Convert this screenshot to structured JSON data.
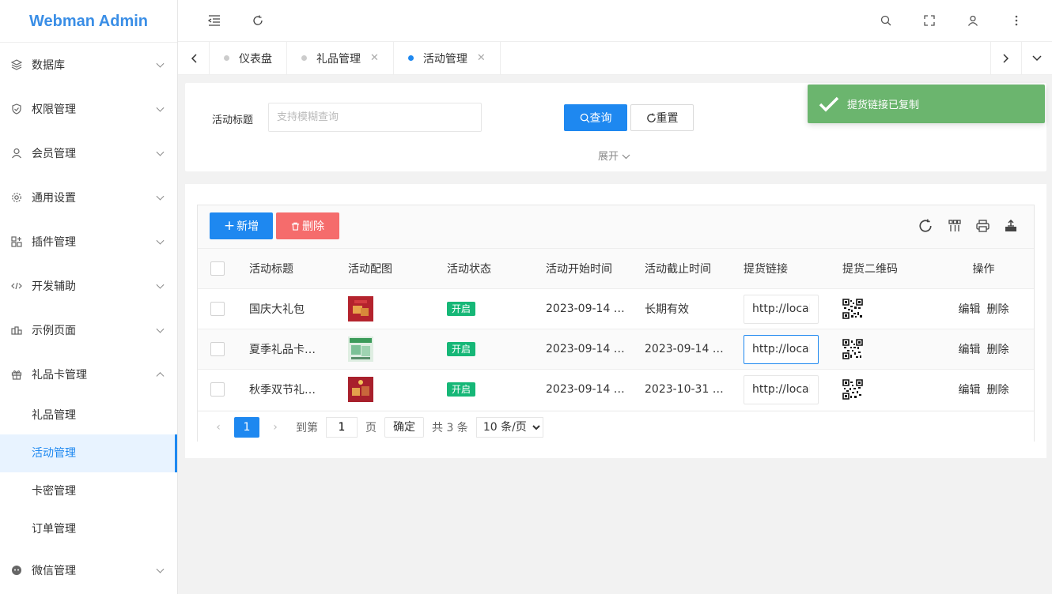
{
  "app": {
    "title": "Webman Admin"
  },
  "sidebar": {
    "items": [
      {
        "label": "数据库",
        "icon": "database-icon"
      },
      {
        "label": "权限管理",
        "icon": "shield-icon"
      },
      {
        "label": "会员管理",
        "icon": "user-icon"
      },
      {
        "label": "通用设置",
        "icon": "gear-icon"
      },
      {
        "label": "插件管理",
        "icon": "plugin-icon"
      },
      {
        "label": "开发辅助",
        "icon": "code-icon"
      },
      {
        "label": "示例页面",
        "icon": "pages-icon"
      },
      {
        "label": "礼品卡管理",
        "icon": "gift-icon",
        "expanded": true
      },
      {
        "label": "微信管理",
        "icon": "wechat-icon"
      }
    ],
    "submenu": [
      "礼品管理",
      "活动管理",
      "卡密管理",
      "订单管理"
    ],
    "active_submenu": "活动管理"
  },
  "tabs": [
    {
      "label": "仪表盘",
      "closable": false,
      "active": false
    },
    {
      "label": "礼品管理",
      "closable": true,
      "active": false
    },
    {
      "label": "活动管理",
      "closable": true,
      "active": true
    }
  ],
  "search": {
    "label": "活动标题",
    "placeholder": "支持模糊查询",
    "query_label": "查询",
    "reset_label": "重置",
    "expand_label": "展开"
  },
  "toolbar": {
    "add_label": "新增",
    "delete_label": "删除"
  },
  "table": {
    "columns": [
      "活动标题",
      "活动配图",
      "活动状态",
      "活动开始时间",
      "活动截止时间",
      "提货链接",
      "提货二维码",
      "操作"
    ],
    "rows": [
      {
        "title": "国庆大礼包",
        "status": "开启",
        "start": "2023-09-14 …",
        "end": "长期有效",
        "link": "http://localhost"
      },
      {
        "title": "夏季礼品卡…",
        "status": "开启",
        "start": "2023-09-14 …",
        "end": "2023-09-14 …",
        "link": "http://localhost"
      },
      {
        "title": "秋季双节礼…",
        "status": "开启",
        "start": "2023-09-14 …",
        "end": "2023-10-31 …",
        "link": "http://localhost"
      }
    ],
    "actions": {
      "edit": "编辑",
      "delete": "删除"
    }
  },
  "pager": {
    "current": "1",
    "goto_prefix": "到第",
    "goto_value": "1",
    "goto_suffix": "页",
    "confirm": "确定",
    "total": "共 3 条",
    "page_size": "10 条/页"
  },
  "toast": {
    "message": "提货链接已复制"
  },
  "colors": {
    "primary": "#1e88f0",
    "danger": "#f56c6c",
    "success": "#16b777",
    "toast": "#6bb56e",
    "logo": "#3a8ee6"
  }
}
